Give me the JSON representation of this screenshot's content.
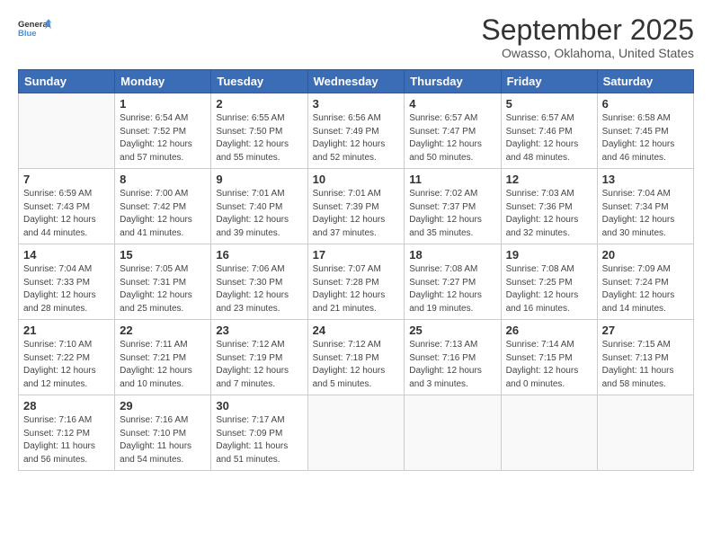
{
  "logo": {
    "line1": "General",
    "line2": "Blue"
  },
  "title": "September 2025",
  "subtitle": "Owasso, Oklahoma, United States",
  "days_header": [
    "Sunday",
    "Monday",
    "Tuesday",
    "Wednesday",
    "Thursday",
    "Friday",
    "Saturday"
  ],
  "weeks": [
    [
      {
        "day": "",
        "info": ""
      },
      {
        "day": "1",
        "info": "Sunrise: 6:54 AM\nSunset: 7:52 PM\nDaylight: 12 hours\nand 57 minutes."
      },
      {
        "day": "2",
        "info": "Sunrise: 6:55 AM\nSunset: 7:50 PM\nDaylight: 12 hours\nand 55 minutes."
      },
      {
        "day": "3",
        "info": "Sunrise: 6:56 AM\nSunset: 7:49 PM\nDaylight: 12 hours\nand 52 minutes."
      },
      {
        "day": "4",
        "info": "Sunrise: 6:57 AM\nSunset: 7:47 PM\nDaylight: 12 hours\nand 50 minutes."
      },
      {
        "day": "5",
        "info": "Sunrise: 6:57 AM\nSunset: 7:46 PM\nDaylight: 12 hours\nand 48 minutes."
      },
      {
        "day": "6",
        "info": "Sunrise: 6:58 AM\nSunset: 7:45 PM\nDaylight: 12 hours\nand 46 minutes."
      }
    ],
    [
      {
        "day": "7",
        "info": "Sunrise: 6:59 AM\nSunset: 7:43 PM\nDaylight: 12 hours\nand 44 minutes."
      },
      {
        "day": "8",
        "info": "Sunrise: 7:00 AM\nSunset: 7:42 PM\nDaylight: 12 hours\nand 41 minutes."
      },
      {
        "day": "9",
        "info": "Sunrise: 7:01 AM\nSunset: 7:40 PM\nDaylight: 12 hours\nand 39 minutes."
      },
      {
        "day": "10",
        "info": "Sunrise: 7:01 AM\nSunset: 7:39 PM\nDaylight: 12 hours\nand 37 minutes."
      },
      {
        "day": "11",
        "info": "Sunrise: 7:02 AM\nSunset: 7:37 PM\nDaylight: 12 hours\nand 35 minutes."
      },
      {
        "day": "12",
        "info": "Sunrise: 7:03 AM\nSunset: 7:36 PM\nDaylight: 12 hours\nand 32 minutes."
      },
      {
        "day": "13",
        "info": "Sunrise: 7:04 AM\nSunset: 7:34 PM\nDaylight: 12 hours\nand 30 minutes."
      }
    ],
    [
      {
        "day": "14",
        "info": "Sunrise: 7:04 AM\nSunset: 7:33 PM\nDaylight: 12 hours\nand 28 minutes."
      },
      {
        "day": "15",
        "info": "Sunrise: 7:05 AM\nSunset: 7:31 PM\nDaylight: 12 hours\nand 25 minutes."
      },
      {
        "day": "16",
        "info": "Sunrise: 7:06 AM\nSunset: 7:30 PM\nDaylight: 12 hours\nand 23 minutes."
      },
      {
        "day": "17",
        "info": "Sunrise: 7:07 AM\nSunset: 7:28 PM\nDaylight: 12 hours\nand 21 minutes."
      },
      {
        "day": "18",
        "info": "Sunrise: 7:08 AM\nSunset: 7:27 PM\nDaylight: 12 hours\nand 19 minutes."
      },
      {
        "day": "19",
        "info": "Sunrise: 7:08 AM\nSunset: 7:25 PM\nDaylight: 12 hours\nand 16 minutes."
      },
      {
        "day": "20",
        "info": "Sunrise: 7:09 AM\nSunset: 7:24 PM\nDaylight: 12 hours\nand 14 minutes."
      }
    ],
    [
      {
        "day": "21",
        "info": "Sunrise: 7:10 AM\nSunset: 7:22 PM\nDaylight: 12 hours\nand 12 minutes."
      },
      {
        "day": "22",
        "info": "Sunrise: 7:11 AM\nSunset: 7:21 PM\nDaylight: 12 hours\nand 10 minutes."
      },
      {
        "day": "23",
        "info": "Sunrise: 7:12 AM\nSunset: 7:19 PM\nDaylight: 12 hours\nand 7 minutes."
      },
      {
        "day": "24",
        "info": "Sunrise: 7:12 AM\nSunset: 7:18 PM\nDaylight: 12 hours\nand 5 minutes."
      },
      {
        "day": "25",
        "info": "Sunrise: 7:13 AM\nSunset: 7:16 PM\nDaylight: 12 hours\nand 3 minutes."
      },
      {
        "day": "26",
        "info": "Sunrise: 7:14 AM\nSunset: 7:15 PM\nDaylight: 12 hours\nand 0 minutes."
      },
      {
        "day": "27",
        "info": "Sunrise: 7:15 AM\nSunset: 7:13 PM\nDaylight: 11 hours\nand 58 minutes."
      }
    ],
    [
      {
        "day": "28",
        "info": "Sunrise: 7:16 AM\nSunset: 7:12 PM\nDaylight: 11 hours\nand 56 minutes."
      },
      {
        "day": "29",
        "info": "Sunrise: 7:16 AM\nSunset: 7:10 PM\nDaylight: 11 hours\nand 54 minutes."
      },
      {
        "day": "30",
        "info": "Sunrise: 7:17 AM\nSunset: 7:09 PM\nDaylight: 11 hours\nand 51 minutes."
      },
      {
        "day": "",
        "info": ""
      },
      {
        "day": "",
        "info": ""
      },
      {
        "day": "",
        "info": ""
      },
      {
        "day": "",
        "info": ""
      }
    ]
  ]
}
